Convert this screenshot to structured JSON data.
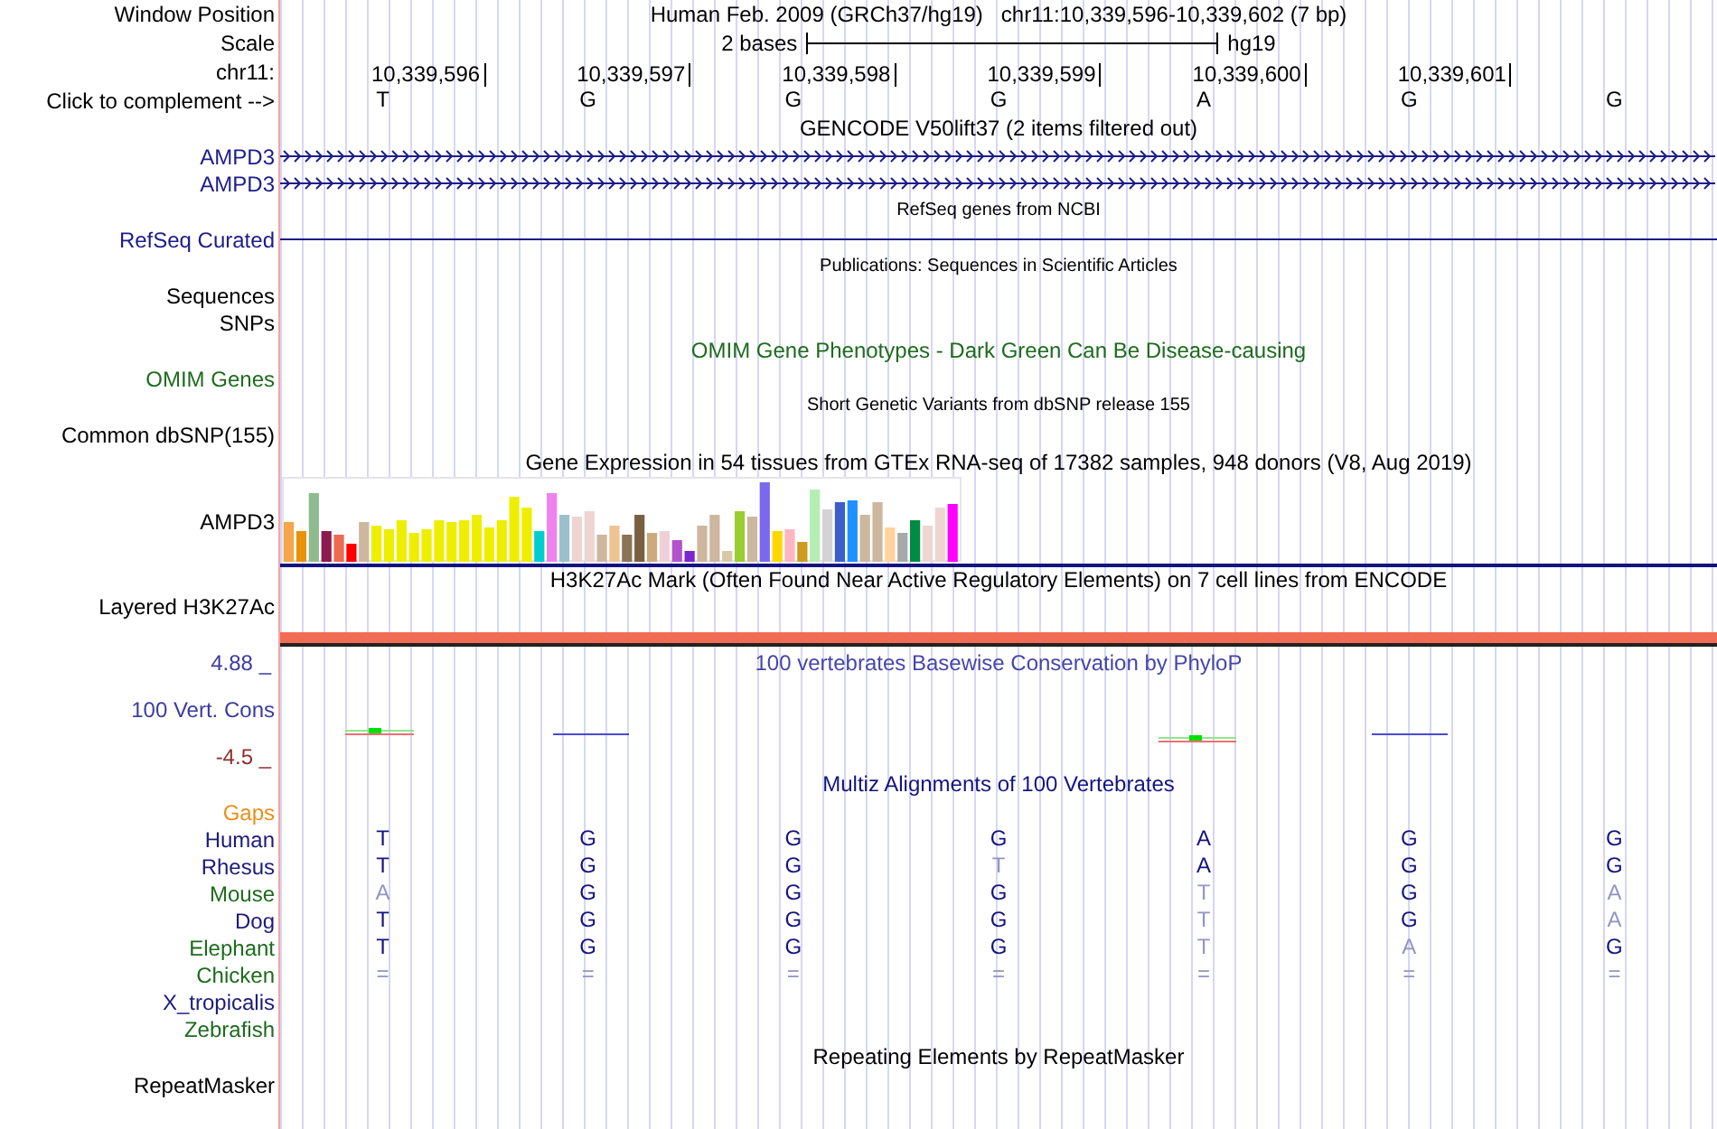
{
  "header": {
    "label": "Window Position",
    "assembly": "Human Feb. 2009 (GRCh37/hg19)",
    "position": "chr11:10,339,596-10,339,602 (7 bp)"
  },
  "scale": {
    "label": "Scale",
    "length": "2 bases",
    "assembly": "hg19"
  },
  "ruler": {
    "label": "chr11:",
    "positions": [
      "10,339,596",
      "10,339,597",
      "10,339,598",
      "10,339,599",
      "10,339,600",
      "10,339,601"
    ]
  },
  "sequence": {
    "label": "Click to complement -->",
    "bases": [
      "T",
      "G",
      "G",
      "G",
      "A",
      "G",
      "G"
    ]
  },
  "tracks": [
    {
      "kind": "gene",
      "title": {
        "text": "GENCODE V50lift37 (2 items filtered out)",
        "color": "#000000"
      },
      "rows": [
        {
          "label": "AMPD3",
          "color": "#1c1c8a"
        },
        {
          "label": "AMPD3",
          "color": "#1c1c8a"
        }
      ]
    },
    {
      "kind": "refseq",
      "title": {
        "text": "RefSeq genes from NCBI",
        "color": "#000000"
      },
      "rows": [
        {
          "label": "RefSeq Curated",
          "color": "#1c1c8a"
        }
      ]
    },
    {
      "kind": "annotation",
      "title": {
        "text": "Publications: Sequences in Scientific Articles",
        "color": "#000000"
      },
      "rows": [
        {
          "label": "Sequences",
          "color": "#000000"
        },
        {
          "label": "SNPs",
          "color": "#000000"
        }
      ]
    },
    {
      "kind": "phenotype",
      "title": {
        "text": "OMIM Gene Phenotypes - Dark Green Can Be Disease-causing",
        "color": "#1e6b1e"
      },
      "rows": [
        {
          "label": "OMIM Genes",
          "color": "#1e6b1e"
        }
      ]
    },
    {
      "kind": "annotation",
      "title": {
        "text": "Short Genetic Variants from dbSNP release 155",
        "color": "#000000"
      },
      "rows": [
        {
          "label": "Common dbSNP(155)",
          "color": "#000000"
        }
      ]
    },
    {
      "kind": "expression",
      "title": {
        "text": "Gene Expression in 54 tissues from GTEx RNA-seq of 17382 samples, 948 donors (V8, Aug 2019)",
        "color": "#000000"
      },
      "rows": [
        {
          "label": "AMPD3",
          "color": "#000000"
        }
      ]
    },
    {
      "kind": "signal",
      "title": {
        "text": "H3K27Ac Mark (Often Found Near Active Regulatory Elements) on 7 cell lines from ENCODE",
        "color": "#000000"
      },
      "rows": [
        {
          "label": "Layered H3K27Ac",
          "color": "#000000"
        }
      ]
    },
    {
      "kind": "conservation",
      "title": {
        "text": "100 vertebrates Basewise Conservation by PhyloP",
        "color": "#4646a8"
      },
      "axis_max": {
        "text": "4.88 _",
        "color": "#3c3ca0"
      },
      "axis_min": {
        "text": "-4.5 _",
        "color": "#8b3030"
      },
      "rows": [
        {
          "label": "100 Vert. Cons",
          "color": "#3c3ca0"
        }
      ]
    },
    {
      "kind": "alignment",
      "title": {
        "text": "Multiz Alignments of 100 Vertebrates",
        "color": "#14147e"
      },
      "rows": [
        {
          "label": "Gaps",
          "color": "#e8901a"
        },
        {
          "label": "Human",
          "color": "#1c1c7a",
          "bases": [
            {
              "text": "T",
              "match": true
            },
            {
              "text": "G",
              "match": true
            },
            {
              "text": "G",
              "match": true
            },
            {
              "text": "G",
              "match": true
            },
            {
              "text": "A",
              "match": true
            },
            {
              "text": "G",
              "match": true
            },
            {
              "text": "G",
              "match": true
            }
          ]
        },
        {
          "label": "Rhesus",
          "color": "#1c1c7a",
          "bases": [
            {
              "text": "T",
              "match": true
            },
            {
              "text": "G",
              "match": true
            },
            {
              "text": "G",
              "match": true
            },
            {
              "text": "T",
              "match": false
            },
            {
              "text": "A",
              "match": true
            },
            {
              "text": "G",
              "match": true
            },
            {
              "text": "G",
              "match": true
            }
          ]
        },
        {
          "label": "Mouse",
          "color": "#1e6b1e",
          "bases": [
            {
              "text": "A",
              "match": false
            },
            {
              "text": "G",
              "match": true
            },
            {
              "text": "G",
              "match": true
            },
            {
              "text": "G",
              "match": true
            },
            {
              "text": "T",
              "match": false
            },
            {
              "text": "G",
              "match": true
            },
            {
              "text": "A",
              "match": false
            }
          ]
        },
        {
          "label": "Dog",
          "color": "#1c1c7a",
          "bases": [
            {
              "text": "T",
              "match": true
            },
            {
              "text": "G",
              "match": true
            },
            {
              "text": "G",
              "match": true
            },
            {
              "text": "G",
              "match": true
            },
            {
              "text": "T",
              "match": false
            },
            {
              "text": "G",
              "match": true
            },
            {
              "text": "A",
              "match": false
            }
          ]
        },
        {
          "label": "Elephant",
          "color": "#1e6b1e",
          "bases": [
            {
              "text": "T",
              "match": true
            },
            {
              "text": "G",
              "match": true
            },
            {
              "text": "G",
              "match": true
            },
            {
              "text": "G",
              "match": true
            },
            {
              "text": "T",
              "match": false
            },
            {
              "text": "A",
              "match": false
            },
            {
              "text": "G",
              "match": true
            }
          ]
        },
        {
          "label": "Chicken",
          "color": "#1e6b1e",
          "bases": [
            {
              "text": "=",
              "match": false
            },
            {
              "text": "=",
              "match": false
            },
            {
              "text": "=",
              "match": false
            },
            {
              "text": "=",
              "match": false
            },
            {
              "text": "=",
              "match": false
            },
            {
              "text": "=",
              "match": false
            },
            {
              "text": "=",
              "match": false
            }
          ]
        },
        {
          "label": "X_tropicalis",
          "color": "#1c1c7a"
        },
        {
          "label": "Zebrafish",
          "color": "#1e6b1e"
        }
      ]
    },
    {
      "kind": "repeat",
      "title": {
        "text": "Repeating Elements by RepeatMasker",
        "color": "#000000"
      },
      "rows": [
        {
          "label": "RepeatMasker",
          "color": "#000000"
        }
      ]
    }
  ]
}
